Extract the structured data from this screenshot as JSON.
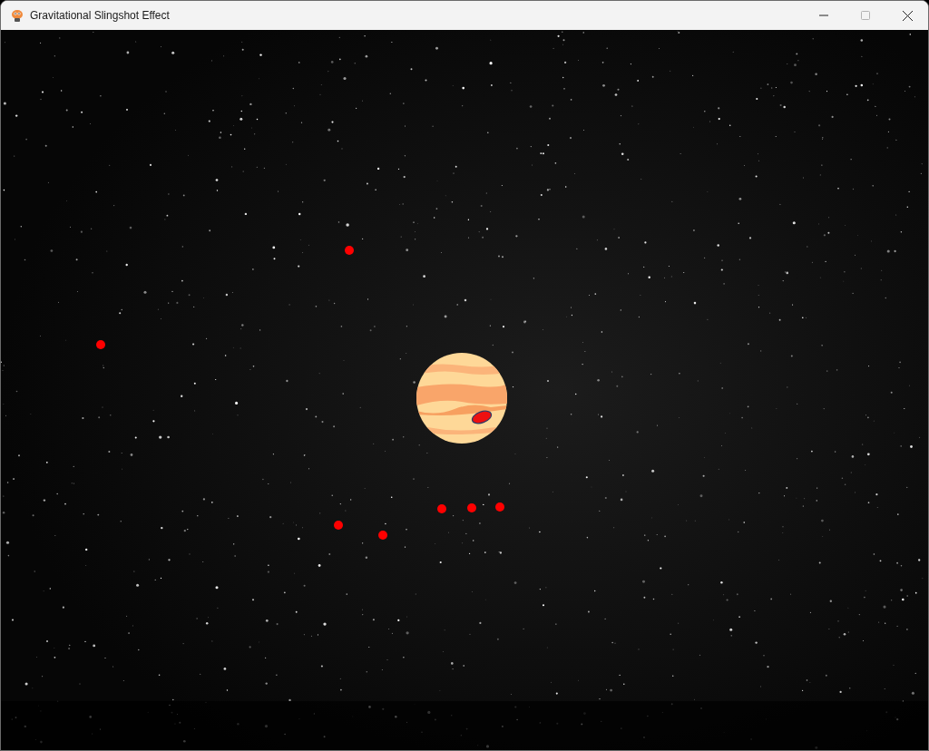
{
  "window": {
    "title": "Gravitational Slingshot Effect",
    "maximize": {
      "disabled": true
    }
  }
}
